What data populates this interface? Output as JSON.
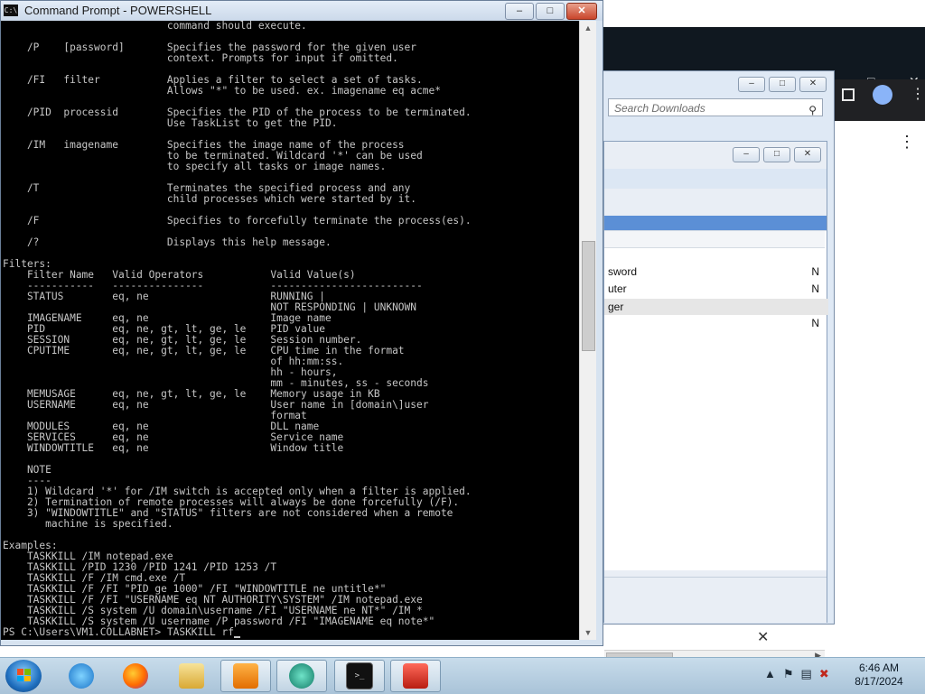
{
  "cmd_window": {
    "title": "Command Prompt - POWERSHELL",
    "icon_text": "C:\\",
    "minimize": "–",
    "maximize": "□",
    "close": "✕"
  },
  "console_text": "                           command should execute.\n\n    /P    [password]       Specifies the password for the given user\n                           context. Prompts for input if omitted.\n\n    /FI   filter           Applies a filter to select a set of tasks.\n                           Allows \"*\" to be used. ex. imagename eq acme*\n\n    /PID  processid        Specifies the PID of the process to be terminated.\n                           Use TaskList to get the PID.\n\n    /IM   imagename        Specifies the image name of the process\n                           to be terminated. Wildcard '*' can be used\n                           to specify all tasks or image names.\n\n    /T                     Terminates the specified process and any\n                           child processes which were started by it.\n\n    /F                     Specifies to forcefully terminate the process(es).\n\n    /?                     Displays this help message.\n\nFilters:\n    Filter Name   Valid Operators           Valid Value(s)\n    -----------   ---------------           -------------------------\n    STATUS        eq, ne                    RUNNING |\n                                            NOT RESPONDING | UNKNOWN\n    IMAGENAME     eq, ne                    Image name\n    PID           eq, ne, gt, lt, ge, le    PID value\n    SESSION       eq, ne, gt, lt, ge, le    Session number.\n    CPUTIME       eq, ne, gt, lt, ge, le    CPU time in the format\n                                            of hh:mm:ss.\n                                            hh - hours,\n                                            mm - minutes, ss - seconds\n    MEMUSAGE      eq, ne, gt, lt, ge, le    Memory usage in KB\n    USERNAME      eq, ne                    User name in [domain\\]user\n                                            format\n    MODULES       eq, ne                    DLL name\n    SERVICES      eq, ne                    Service name\n    WINDOWTITLE   eq, ne                    Window title\n\n    NOTE\n    ----\n    1) Wildcard '*' for /IM switch is accepted only when a filter is applied.\n    2) Termination of remote processes will always be done forcefully (/F).\n    3) \"WINDOWTITLE\" and \"STATUS\" filters are not considered when a remote\n       machine is specified.\n\nExamples:\n    TASKKILL /IM notepad.exe\n    TASKKILL /PID 1230 /PID 1241 /PID 1253 /T\n    TASKKILL /F /IM cmd.exe /T\n    TASKKILL /F /FI \"PID ge 1000\" /FI \"WINDOWTITLE ne untitle*\"\n    TASKKILL /F /FI \"USERNAME eq NT AUTHORITY\\SYSTEM\" /IM notepad.exe\n    TASKKILL /S system /U domain\\username /FI \"USERNAME ne NT*\" /IM *\n    TASKKILL /S system /U username /P password /FI \"IMAGENAME eq note*\"",
  "prompt_line": "PS C:\\Users\\VM1.COLLABNET> TASKKILL rf",
  "explorer": {
    "search_placeholder": "Search Downloads",
    "rows": [
      {
        "label": "sword",
        "value": "N"
      },
      {
        "label": "uter",
        "value": "N"
      },
      {
        "label": "ger",
        "value": ""
      },
      {
        "label": "",
        "value": "N"
      }
    ]
  },
  "taskbar": {
    "apps": [
      "internet-explorer",
      "firefox",
      "file-explorer",
      "media-player",
      "media-center",
      "command-prompt",
      "toolbox"
    ],
    "clock_time": "6:46 AM",
    "clock_date": "8/17/2024"
  },
  "colors": {
    "console_bg": "#000000",
    "console_fg": "#c6c6c6",
    "taskbar": "#b8cfe2"
  }
}
